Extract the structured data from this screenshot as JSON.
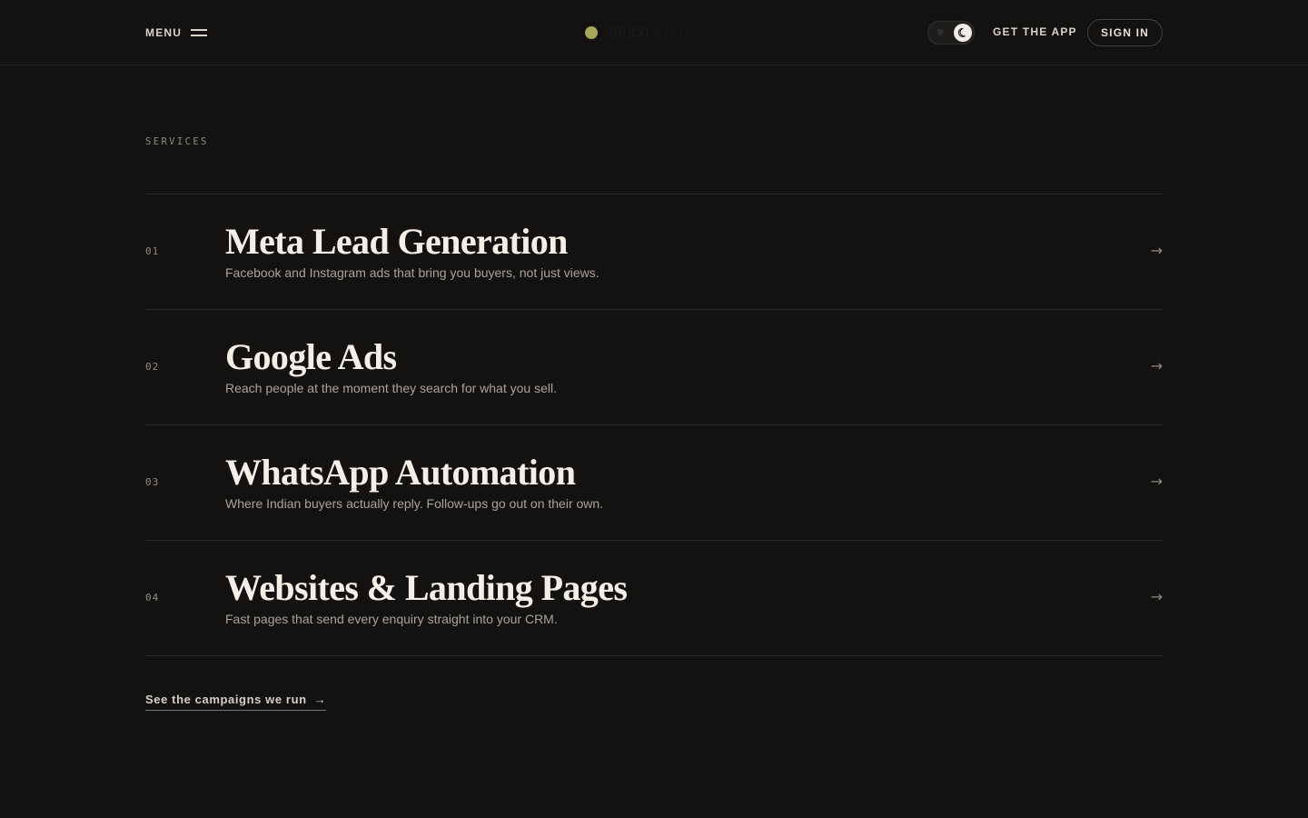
{
  "header": {
    "menu_label": "MENU",
    "logo_word": "tauco",
    "logo_sub": "MEDIA",
    "get_app_label": "GET THE APP",
    "sign_in_label": "SIGN IN",
    "theme": "dark"
  },
  "section": {
    "label": "SERVICES"
  },
  "services": [
    {
      "num": "01",
      "title": "Meta Lead Generation",
      "desc": "Facebook and Instagram ads that bring you buyers, not just views.",
      "arrow": "→"
    },
    {
      "num": "02",
      "title": "Google Ads",
      "desc": "Reach people at the moment they search for what you sell.",
      "arrow": "→"
    },
    {
      "num": "03",
      "title": "WhatsApp Automation",
      "desc": "Where Indian buyers actually reply. Follow-ups go out on their own.",
      "arrow": "→"
    },
    {
      "num": "04",
      "title": "Websites & Landing Pages",
      "desc": "Fast pages that send every enquiry straight into your CRM.",
      "arrow": "→"
    }
  ],
  "cta": {
    "label": "See the campaigns we run",
    "arrow": "→"
  },
  "colors": {
    "background": "#141211",
    "text": "#efe9df",
    "muted": "#8f8a82",
    "logo_dot": "#a8a85a"
  }
}
